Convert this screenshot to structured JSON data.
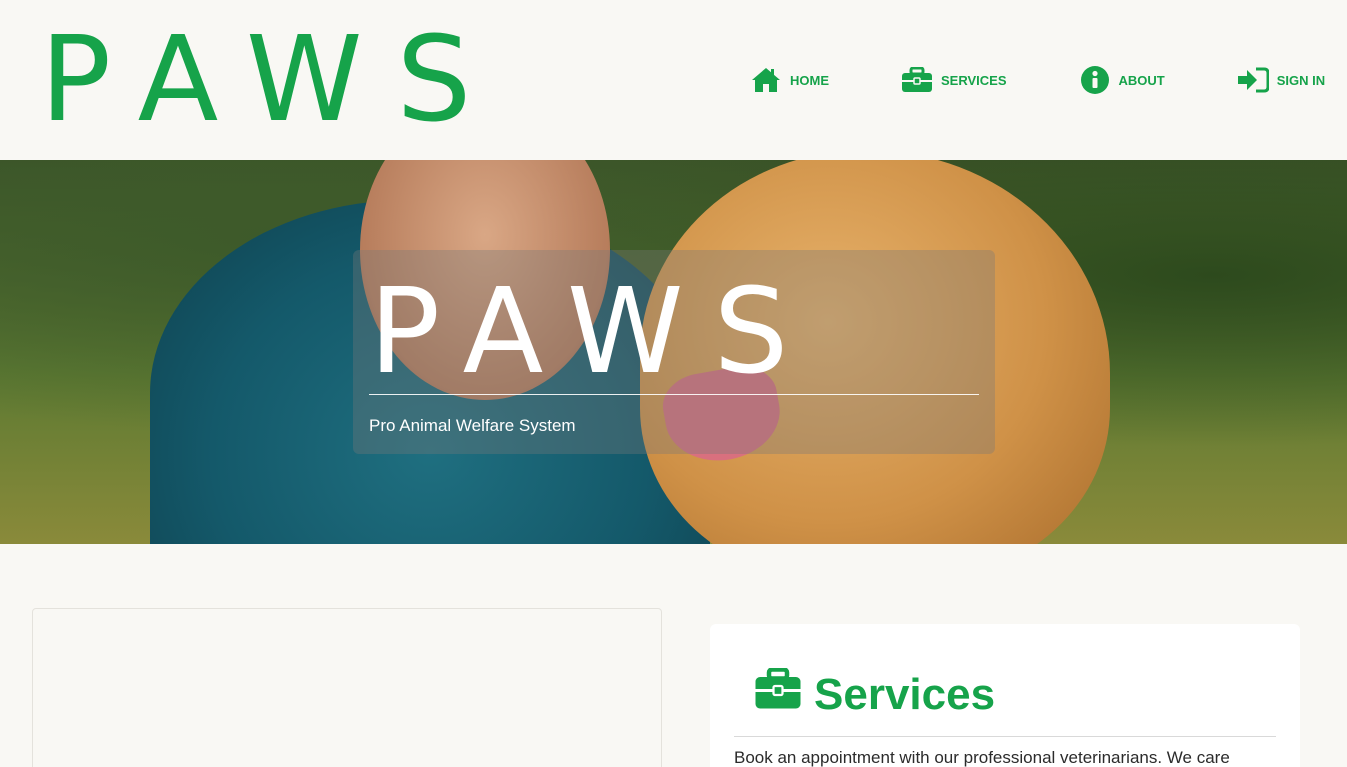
{
  "header": {
    "logo": "PAWS",
    "nav": [
      {
        "label": "HOME",
        "icon": "home-icon"
      },
      {
        "label": "SERVICES",
        "icon": "briefcase-icon"
      },
      {
        "label": "ABOUT",
        "icon": "info-icon"
      },
      {
        "label": "SIGN IN",
        "icon": "sign-in-icon"
      }
    ]
  },
  "hero": {
    "title": "PAWS",
    "subtitle": "Pro Animal Welfare System"
  },
  "services": {
    "heading": "Services",
    "icon": "briefcase-icon",
    "description": "Book an appointment with our professional veterinarians. We care"
  },
  "colors": {
    "accent": "#16a34a",
    "background": "#f9f8f4"
  }
}
